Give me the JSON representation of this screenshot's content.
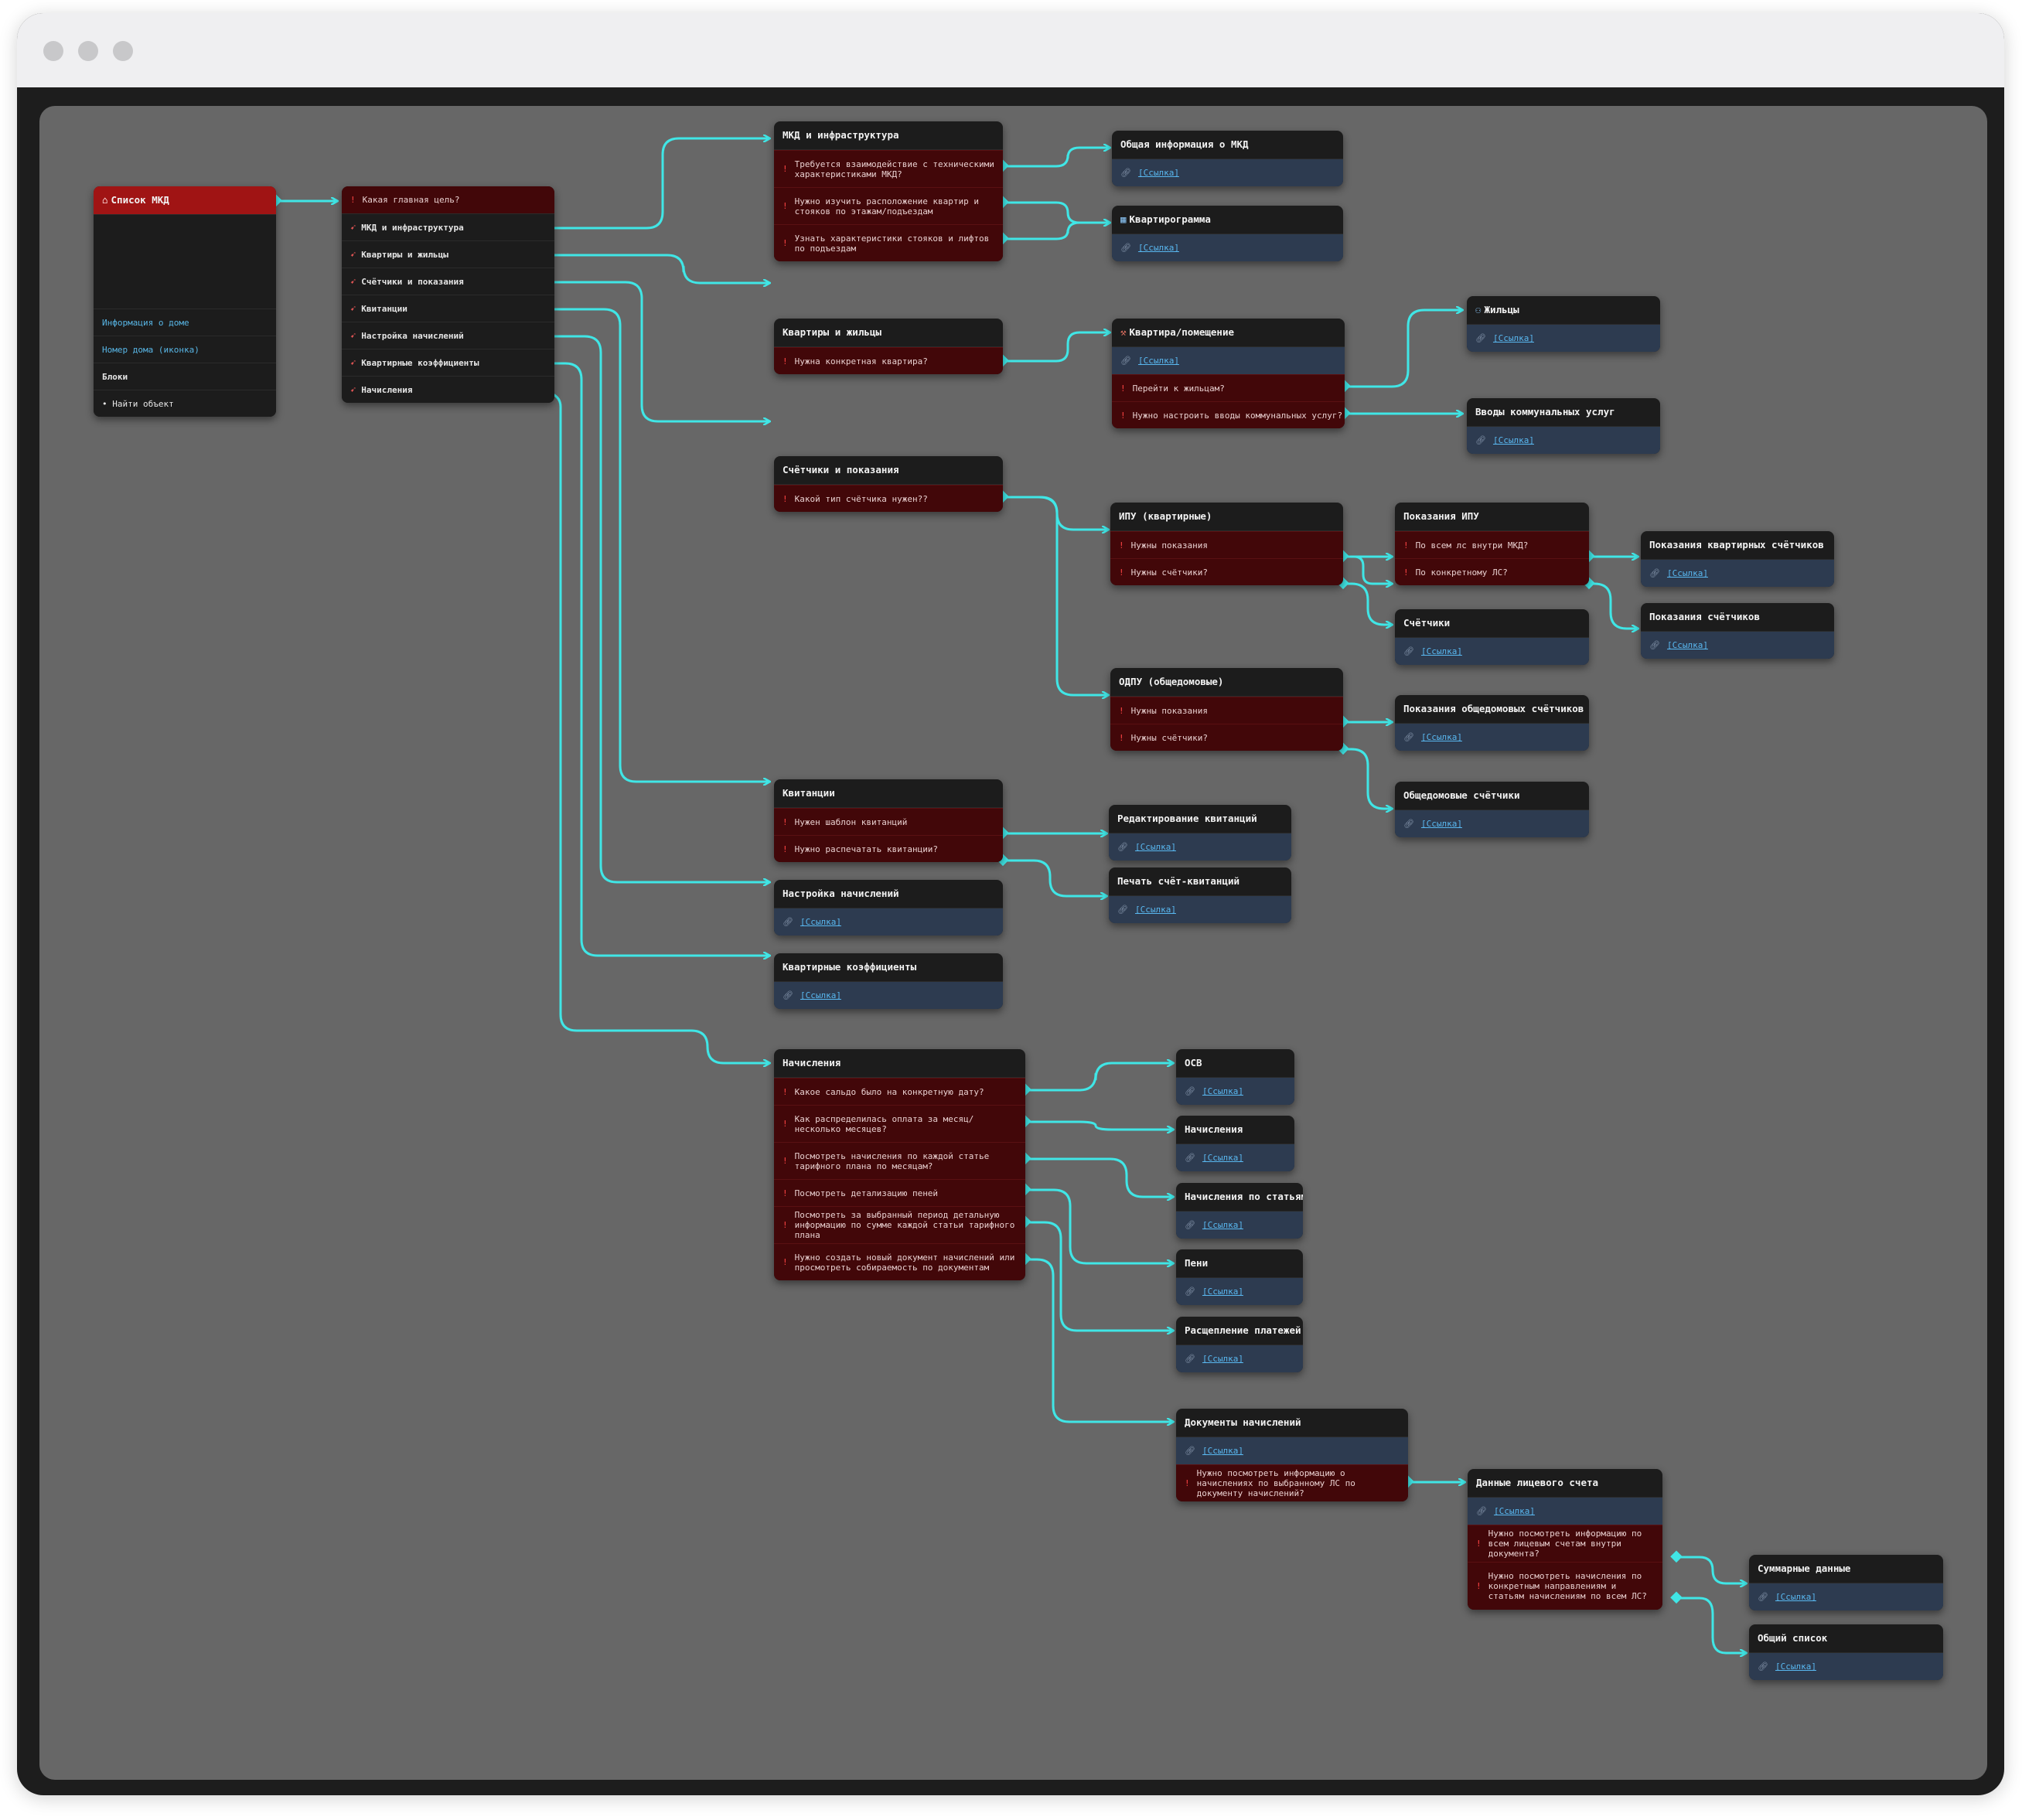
{
  "colors": {
    "wire": "#40e6e6",
    "canvas": "#676767",
    "node": "#1c1c1c",
    "question": "#420709",
    "link_row": "#2d3b50",
    "root_header": "#a01414"
  },
  "link_text": "[Ссылка]",
  "icons": {
    "question": "red-exclamation-icon",
    "link": "link-icon",
    "menu_item": "rocket-icon",
    "house": "house-icon",
    "chart": "chart-icon",
    "hammer": "hammer-icon",
    "people": "people-icon"
  },
  "root": {
    "title": "Список МКД",
    "items": [
      "Информация о доме",
      "Номер дома (иконка)",
      "Блоки",
      "• Найти объект"
    ]
  },
  "menu": {
    "question": "Какая главная цель?",
    "items": [
      "МКД и инфраструктура",
      "Квартиры и жильцы",
      "Счётчики и показания",
      "Квитанции",
      "Настройка начислений",
      "Квартирные коэффициенты",
      "Начисления"
    ]
  },
  "infra": {
    "title": "МКД и инфраструктура",
    "questions": [
      "Требуется взаимодействие с техническими характеристиками МКД?",
      "Нужно изучить расположение квартир и стояков по этажам/подъездам",
      "Узнать характеристики стояков и лифтов по подъездам"
    ]
  },
  "general_info": {
    "title": "Общая информация о МКД"
  },
  "kvartirogramma": {
    "title": "Квартирограмма"
  },
  "apartments": {
    "title": "Квартиры и жильцы",
    "questions": [
      "Нужна конкретная квартира?"
    ]
  },
  "apartment": {
    "title": "Квартира/помещение",
    "questions": [
      "Перейти к жильцам?",
      "Нужно настроить вводы коммунальных услуг?"
    ]
  },
  "residents": {
    "title": "Жильцы"
  },
  "utility_inputs": {
    "title": "Вводы коммунальных услуг"
  },
  "meters": {
    "title": "Счётчики и показания",
    "questions": [
      "Какой тип счётчика нужен??"
    ]
  },
  "ipu": {
    "title": "ИПУ (квартирные)",
    "questions": [
      "Нужны показания",
      "Нужны счётчики?"
    ]
  },
  "ipu_readings": {
    "title": "Показания ИПУ",
    "questions": [
      "По всем лс внутри МКД?",
      "По конкретному ЛС?"
    ]
  },
  "apt_meter_readings": {
    "title": "Показания квартирных счётчиков"
  },
  "meter_readings": {
    "title": "Показания счётчиков"
  },
  "meters_list": {
    "title": "Счётчики"
  },
  "odpu": {
    "title": "ОДПУ (общедомовые)",
    "questions": [
      "Нужны показания",
      "Нужны счётчики?"
    ]
  },
  "odpu_readings": {
    "title": "Показания общедомовых счётчиков"
  },
  "odpu_meters": {
    "title": "Общедомовые счётчики"
  },
  "receipts": {
    "title": "Квитанции",
    "questions": [
      "Нужен шаблон квитанций",
      "Нужно распечатать квитанции?"
    ]
  },
  "edit_receipts": {
    "title": "Редактирование квитанций"
  },
  "print_receipts": {
    "title": "Печать счёт-квитанций"
  },
  "charge_settings": {
    "title": "Настройка начислений"
  },
  "coefficients": {
    "title": "Квартирные коэффициенты"
  },
  "charges": {
    "title": "Начисления",
    "questions": [
      "Какое сальдо было на конкретную дату?",
      "Как распределилась оплата за месяц/несколько месяцев?",
      "Посмотреть начисления по каждой статье тарифного плана по месяцам?",
      "Посмотреть детализацию пеней",
      "Посмотреть за выбранный период детальную информацию по сумме каждой статьи тарифного плана",
      "Нужно создать новый документ начислений или просмотреть собираемость по документам"
    ]
  },
  "osv": {
    "title": "ОСВ"
  },
  "charges_page": {
    "title": "Начисления"
  },
  "charges_by_item": {
    "title": "Начисления по статьям"
  },
  "penalties": {
    "title": "Пени"
  },
  "payment_split": {
    "title": "Расщепление платежей"
  },
  "charge_docs": {
    "title": "Документы начислений",
    "questions": [
      "Нужно посмотреть информацию о начислениях по выбранному ЛС по документу начислений?"
    ]
  },
  "account_data": {
    "title": "Данные лицевого счета",
    "questions": [
      "Нужно посмотреть информацию по всем лицевым счетам внутри документа?",
      "Нужно посмотреть начисления по конкретным направлениям и статьям начислениям по всем ЛС?"
    ]
  },
  "summary": {
    "title": "Суммарные данные"
  },
  "general_list": {
    "title": "Общий список"
  }
}
